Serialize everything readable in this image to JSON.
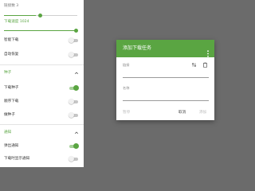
{
  "settings": {
    "slider1": {
      "label": "链接数 3",
      "value_fraction": 0.44
    },
    "slider2": {
      "label": "下载速度 1024",
      "value_fraction": 1.0
    },
    "rows_top": [
      {
        "label": "智能下载",
        "on": false
      },
      {
        "label": "自动恢复",
        "on": false
      }
    ],
    "section_seed": {
      "title": "种子",
      "rows": [
        {
          "label": "下载种子",
          "on": true
        },
        {
          "label": "顺序下载",
          "on": false
        },
        {
          "label": "做种子",
          "on": false
        }
      ]
    },
    "section_notify": {
      "title": "通知",
      "rows": [
        {
          "label": "弹出通知",
          "on": true
        },
        {
          "label": "下载时显示通知",
          "on": false
        }
      ]
    }
  },
  "dialog": {
    "title": "添加下载任务",
    "link_label": "链接",
    "link_value": "",
    "name_label": "名称",
    "name_value": "",
    "buttons": {
      "left": "暂停",
      "cancel": "取消",
      "add": "添加"
    }
  },
  "icons": {
    "more": "more-vert-icon",
    "swap": "swap-vert-icon",
    "paste": "clipboard-icon",
    "chevron": "chevron-up-icon"
  },
  "colors": {
    "accent": "#5aa542",
    "scrim": "#6b6b6b"
  }
}
